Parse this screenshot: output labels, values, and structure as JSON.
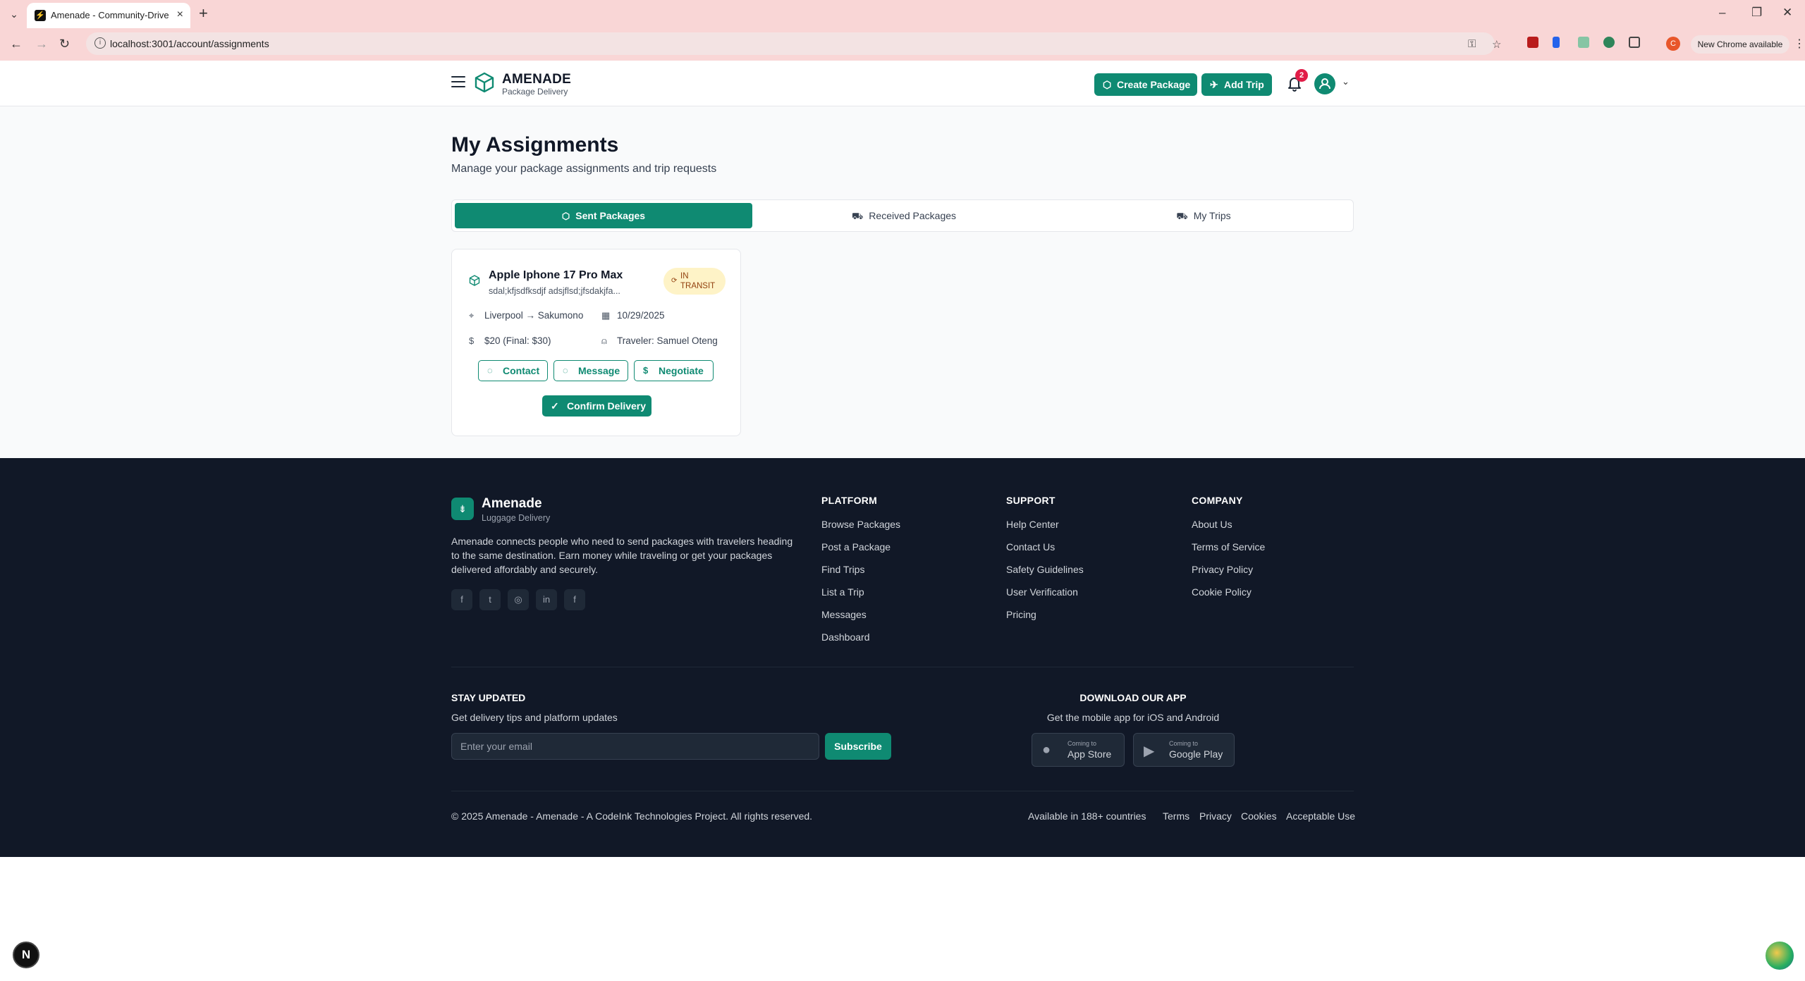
{
  "browser": {
    "tab_title": "Amenade - Community-Driven",
    "url": "localhost:3001/account/assignments",
    "update_label": "New Chrome available",
    "profile_initial": "C"
  },
  "header": {
    "brand": "AMENADE",
    "brand_sub": "Package Delivery",
    "create_package": "Create Package",
    "add_trip": "Add Trip",
    "notification_count": "2"
  },
  "page": {
    "title": "My Assignments",
    "subtitle": "Manage your package assignments and trip requests",
    "tabs": [
      {
        "label": "Sent Packages",
        "active": true
      },
      {
        "label": "Received Packages",
        "active": false
      },
      {
        "label": "My Trips",
        "active": false
      }
    ]
  },
  "assignment": {
    "title": "Apple Iphone 17 Pro Max",
    "description": "sdal;kfjsdfksdjf adsjflsd;jfsdakjfa...",
    "status_line1": "IN",
    "status_line2": "TRANSIT",
    "route": "Liverpool → Sakumono",
    "date": "10/29/2025",
    "price": "$20 (Final: $30)",
    "traveler": "Traveler: Samuel Oteng",
    "contact": "Contact",
    "message": "Message",
    "negotiate": "Negotiate",
    "confirm": "Confirm Delivery"
  },
  "footer": {
    "brand": "Amenade",
    "brand_sub": "Luggage Delivery",
    "description": "Amenade connects people who need to send packages with travelers heading to the same destination. Earn money while traveling or get your packages delivered affordably and securely.",
    "columns": [
      {
        "title": "PLATFORM",
        "links": [
          "Browse Packages",
          "Post a Package",
          "Find Trips",
          "List a Trip",
          "Messages",
          "Dashboard"
        ]
      },
      {
        "title": "SUPPORT",
        "links": [
          "Help Center",
          "Contact Us",
          "Safety Guidelines",
          "User Verification",
          "Pricing"
        ]
      },
      {
        "title": "COMPANY",
        "links": [
          "About Us",
          "Terms of Service",
          "Privacy Policy",
          "Cookie Policy"
        ]
      }
    ],
    "stay_title": "STAY UPDATED",
    "stay_sub": "Get delivery tips and platform updates",
    "email_placeholder": "Enter your email",
    "subscribe": "Subscribe",
    "download_title": "DOWNLOAD OUR APP",
    "download_sub": "Get the mobile app for iOS and Android",
    "app_store_small": "Coming to",
    "app_store": "App Store",
    "google_play_small": "Coming to",
    "google_play": "Google Play",
    "copyright": "© 2025 Amenade - Amenade - A CodeInk Technologies Project. All rights reserved.",
    "bottom_links": [
      "Available in 188+ countries",
      "Terms",
      "Privacy",
      "Cookies",
      "Acceptable Use"
    ]
  },
  "colors": {
    "accent": "#0f8a72",
    "footer_bg": "#111827",
    "status_bg": "#fef3c7",
    "chrome_bg": "#f9d6d6"
  }
}
